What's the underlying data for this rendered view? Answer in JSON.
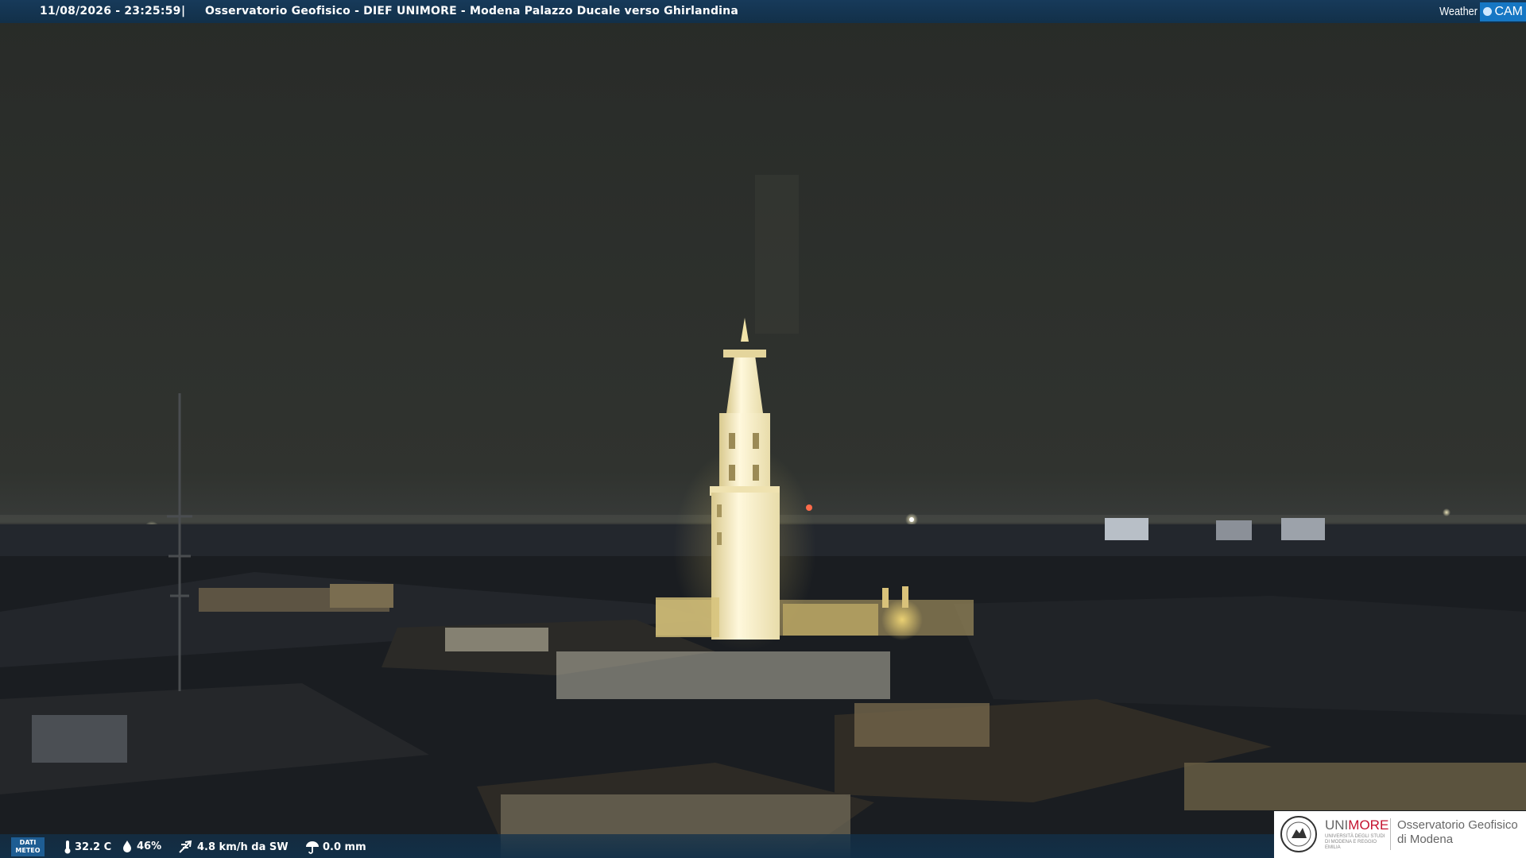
{
  "overlay": {
    "timestamp": "11/08/2026 - 23:25:59",
    "separator": "|",
    "camera_title": "Osservatorio Geofisico - DIEF UNIMORE - Modena Palazzo Ducale verso Ghirlandina",
    "brand_left": "Weather",
    "brand_right": "CAM"
  },
  "weather": {
    "badge": [
      "DATI",
      "METEO"
    ],
    "temperature": "32.2 C",
    "humidity": "46%",
    "wind": "4.8 km/h da SW",
    "rain": "0.0 mm"
  },
  "unimore": {
    "name_grey": "UNI",
    "name_red": "MORE",
    "subtitle": "UNIVERSITÀ DEGLI STUDI DI MODENA E REGGIO EMILIA",
    "observatory_line1": "Osservatorio Geofisico",
    "observatory_line2": "di Modena"
  },
  "colors": {
    "sky": "#2b2e2a",
    "tower_lit": "#fff7d6",
    "bar": "#123049",
    "unimore_red": "#c4122f"
  }
}
